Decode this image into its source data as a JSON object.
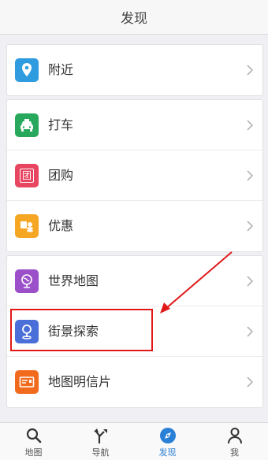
{
  "header": {
    "title": "发现"
  },
  "groups": [
    {
      "items": [
        {
          "label": "附近",
          "icon": "location-pin-icon"
        }
      ]
    },
    {
      "items": [
        {
          "label": "打车",
          "icon": "taxi-icon"
        },
        {
          "label": "团购",
          "icon": "group-buy-icon",
          "glyph": "团"
        },
        {
          "label": "优惠",
          "icon": "coupon-coins-icon"
        }
      ]
    },
    {
      "items": [
        {
          "label": "世界地图",
          "icon": "globe-icon"
        },
        {
          "label": "街景探索",
          "icon": "streetview-pin-icon"
        },
        {
          "label": "地图明信片",
          "icon": "postcard-icon"
        }
      ]
    }
  ],
  "tabbar": {
    "tabs": [
      {
        "label": "地图",
        "icon": "search-icon"
      },
      {
        "label": "导航",
        "icon": "navigation-fork-icon"
      },
      {
        "label": "发现",
        "icon": "compass-icon",
        "active": true
      },
      {
        "label": "我",
        "icon": "person-icon"
      }
    ]
  },
  "colors": {
    "nearby": "#2f9ce0",
    "taxi": "#28a85c",
    "groupbuy": "#e84560",
    "coupon": "#f5a623",
    "world": "#9b4fc9",
    "streetview": "#4a6fd9",
    "postcard": "#f26b1d",
    "active_tab": "#2a7fd6",
    "annotation": "#e01818"
  }
}
